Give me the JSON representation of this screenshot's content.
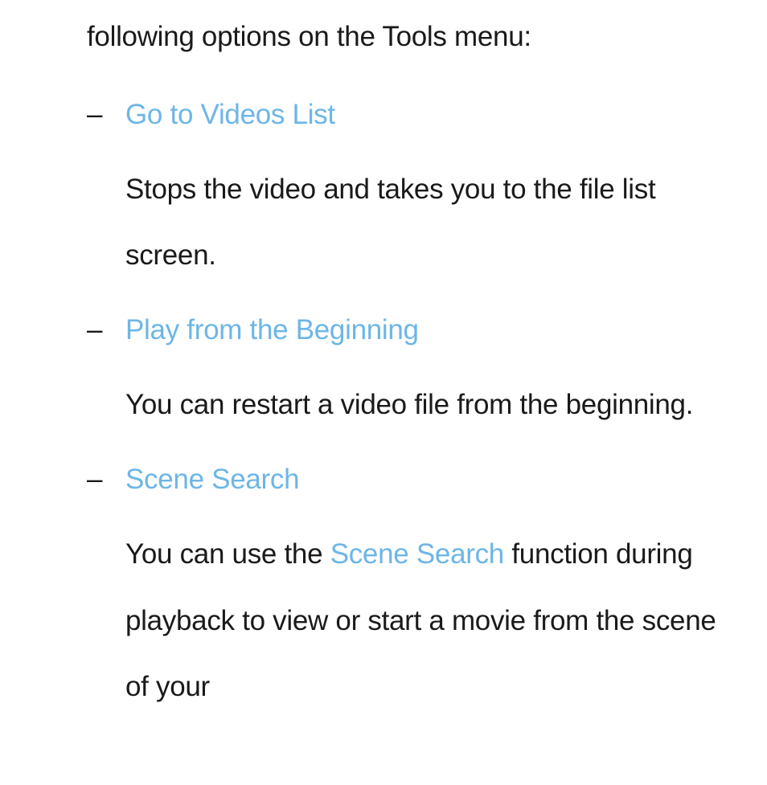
{
  "intro": "following options on the Tools menu:",
  "items": [
    {
      "dash": "–",
      "title": "Go to Videos List",
      "desc": "Stops the video and takes you to the file list screen."
    },
    {
      "dash": "–",
      "title": "Play from the Beginning",
      "desc": "You can restart a video file from the beginning."
    },
    {
      "dash": "–",
      "title": "Scene Search",
      "desc_prefix": "You can use the ",
      "desc_highlight": "Scene Search",
      "desc_suffix": " function during playback to view or start a movie from the scene of your"
    }
  ]
}
